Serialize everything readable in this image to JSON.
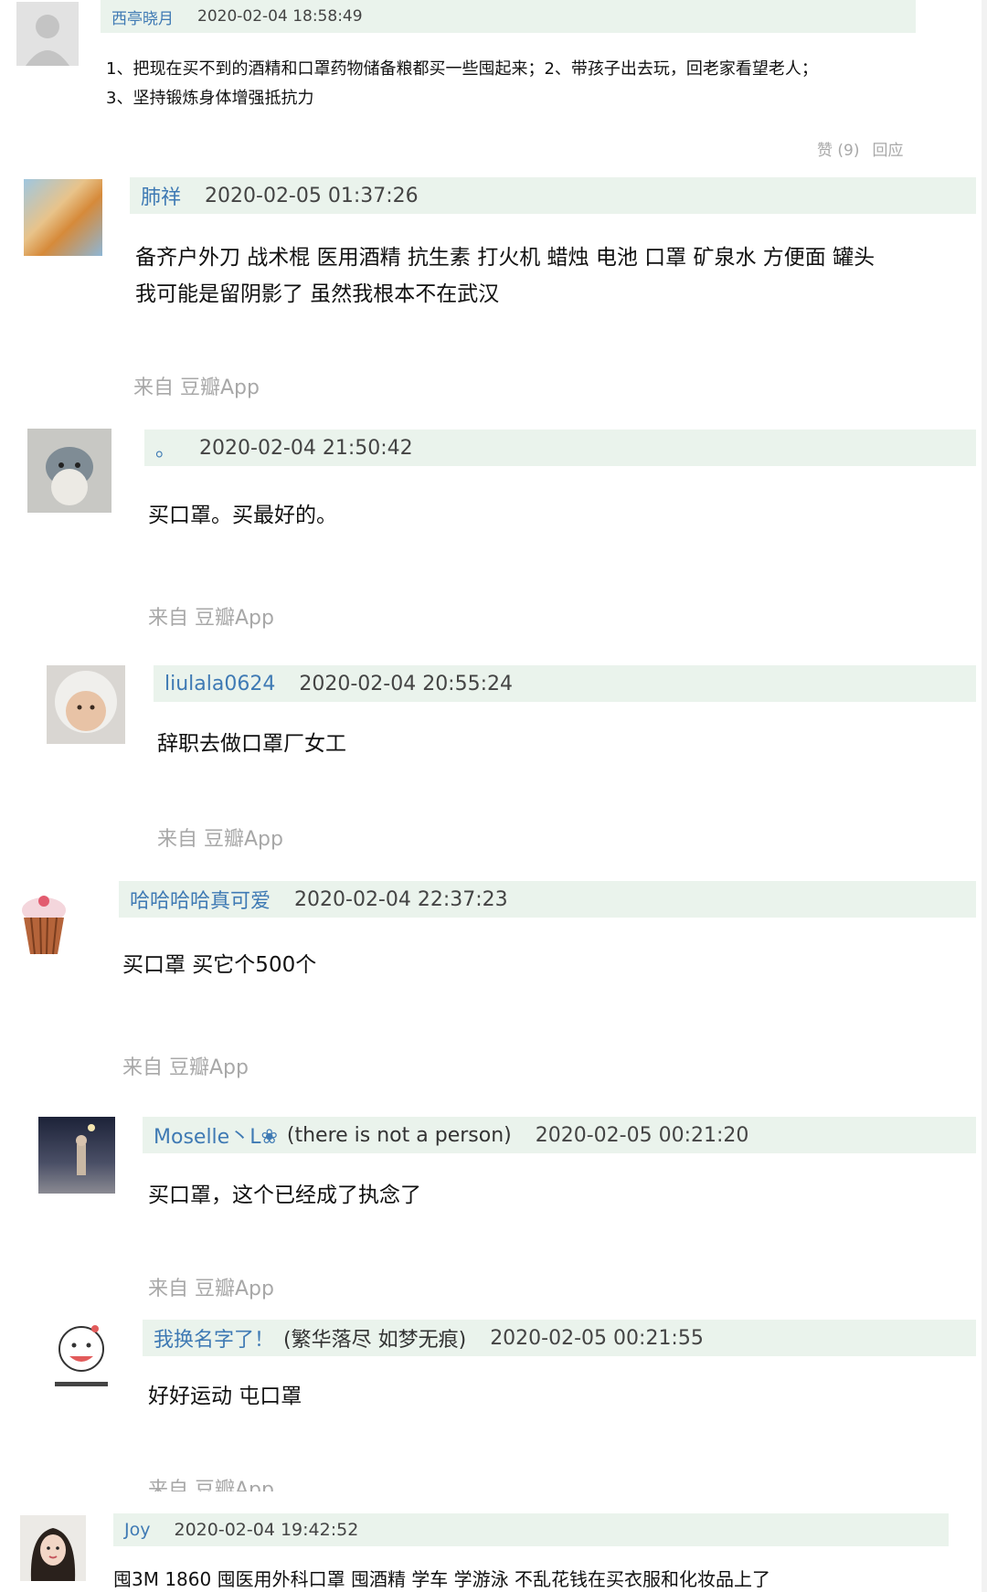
{
  "comments": [
    {
      "author": "西亭晓月",
      "author_extra": "",
      "time": "2020-02-04 18:58:49",
      "text": "1、把现在买不到的酒精和口罩药物储备粮都买一些囤起来；2、带孩子出去玩，回老家看望老人；\n3、坚持锻炼身体增强抵抗力",
      "source": "",
      "likes_label": "赞 (9)",
      "reply_label": "回应",
      "avatar_icon": "default-user-icon"
    },
    {
      "author": "肺祥",
      "author_extra": "",
      "time": "2020-02-05 01:37:26",
      "text": "备齐户外刀 战术棍 医用酒精 抗生素 打火机 蜡烛 电池 口罩 矿泉水 方便面 罐头\n我可能是留阴影了 虽然我根本不在武汉",
      "source": "来自 豆瓣App",
      "avatar_icon": "painting-avatar"
    },
    {
      "author": "。",
      "author_extra": "",
      "time": "2020-02-04 21:50:42",
      "text": "买口罩。买最好的。",
      "source": "来自 豆瓣App",
      "avatar_icon": "bird-avatar"
    },
    {
      "author": "liulala0624",
      "author_extra": "",
      "time": "2020-02-04 20:55:24",
      "text": "辞职去做口罩厂女工",
      "source": "来自 豆瓣App",
      "avatar_icon": "baby-avatar"
    },
    {
      "author": "哈哈哈哈真可爱",
      "author_extra": "",
      "time": "2020-02-04 22:37:23",
      "text": "买口罩 买它个500个",
      "source": "来自 豆瓣App",
      "avatar_icon": "cupcake-avatar"
    },
    {
      "author": "Moselle丶L❀",
      "author_extra": "(there is not a person)",
      "time": "2020-02-05 00:21:20",
      "text": "买口罩，这个已经成了执念了",
      "source": "来自 豆瓣App",
      "avatar_icon": "night-street-avatar"
    },
    {
      "author": "我换名字了！",
      "author_extra": "(繁华落尽 如梦无痕)",
      "time": "2020-02-05 00:21:55",
      "text": "好好运动 屯口罩",
      "source": "来自 豆瓣App",
      "avatar_icon": "cartoon-avatar"
    },
    {
      "author": "Joy",
      "author_extra": "",
      "time": "2020-02-04 19:42:52",
      "text": "囤3M 1860 囤医用外科口罩 囤酒精 学车 学游泳 不乱花钱在买衣服和化妆品上了",
      "source": "",
      "avatar_icon": "girl-avatar"
    }
  ]
}
